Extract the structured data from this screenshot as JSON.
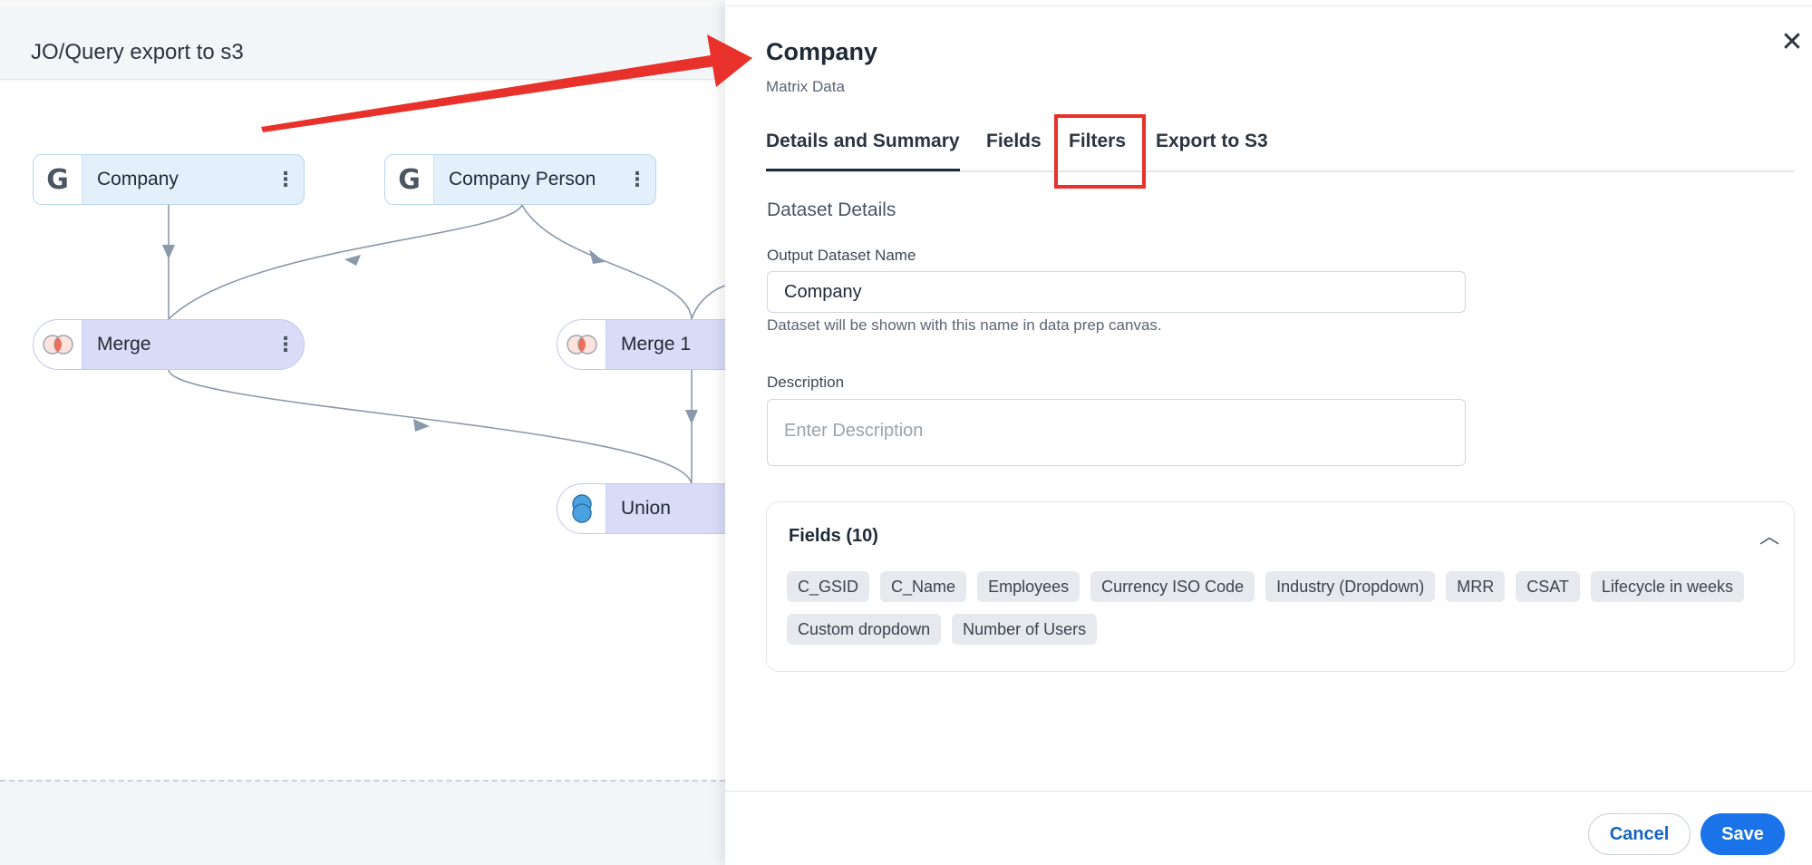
{
  "canvas": {
    "title": "JO/Query export to s3",
    "nodes": {
      "company": {
        "label": "Company",
        "icon": "google-g-icon",
        "icon_glyph": "G"
      },
      "company_person": {
        "label": "Company Person",
        "icon": "google-g-icon",
        "icon_glyph": "G"
      },
      "merge": {
        "label": "Merge",
        "icon": "merge-icon"
      },
      "merge1": {
        "label": "Merge 1",
        "icon": "merge-icon"
      },
      "union": {
        "label": "Union",
        "icon": "union-icon"
      }
    },
    "menu_glyph": "⋮"
  },
  "drawer": {
    "title": "Company",
    "subtitle": "Matrix Data",
    "close_glyph": "✕",
    "tabs": [
      "Details and Summary",
      "Fields",
      "Filters",
      "Export to S3"
    ],
    "active_tab": "Details and Summary",
    "highlighted_tab": "Filters",
    "section_heading": "Dataset Details",
    "output_name": {
      "label": "Output Dataset Name",
      "value": "Company",
      "hint": "Dataset will be shown with this name in data prep canvas."
    },
    "description": {
      "label": "Description",
      "placeholder": "Enter Description"
    },
    "fields_card": {
      "title": "Fields (10)",
      "toggle_glyph": "︿",
      "chips": [
        "C_GSID",
        "C_Name",
        "Employees",
        "Currency ISO Code",
        "Industry (Dropdown)",
        "MRR",
        "CSAT",
        "Lifecycle in weeks",
        "Custom dropdown",
        "Number of Users"
      ]
    },
    "footer": {
      "cancel_label": "Cancel",
      "save_label": "Save"
    }
  },
  "colors": {
    "accent": "#1a73e8",
    "annotation": "#e8312a",
    "source_node_bg": "#e3f0fb",
    "operation_node_bg": "#d9dcf7",
    "edge": "#8a99ab"
  }
}
